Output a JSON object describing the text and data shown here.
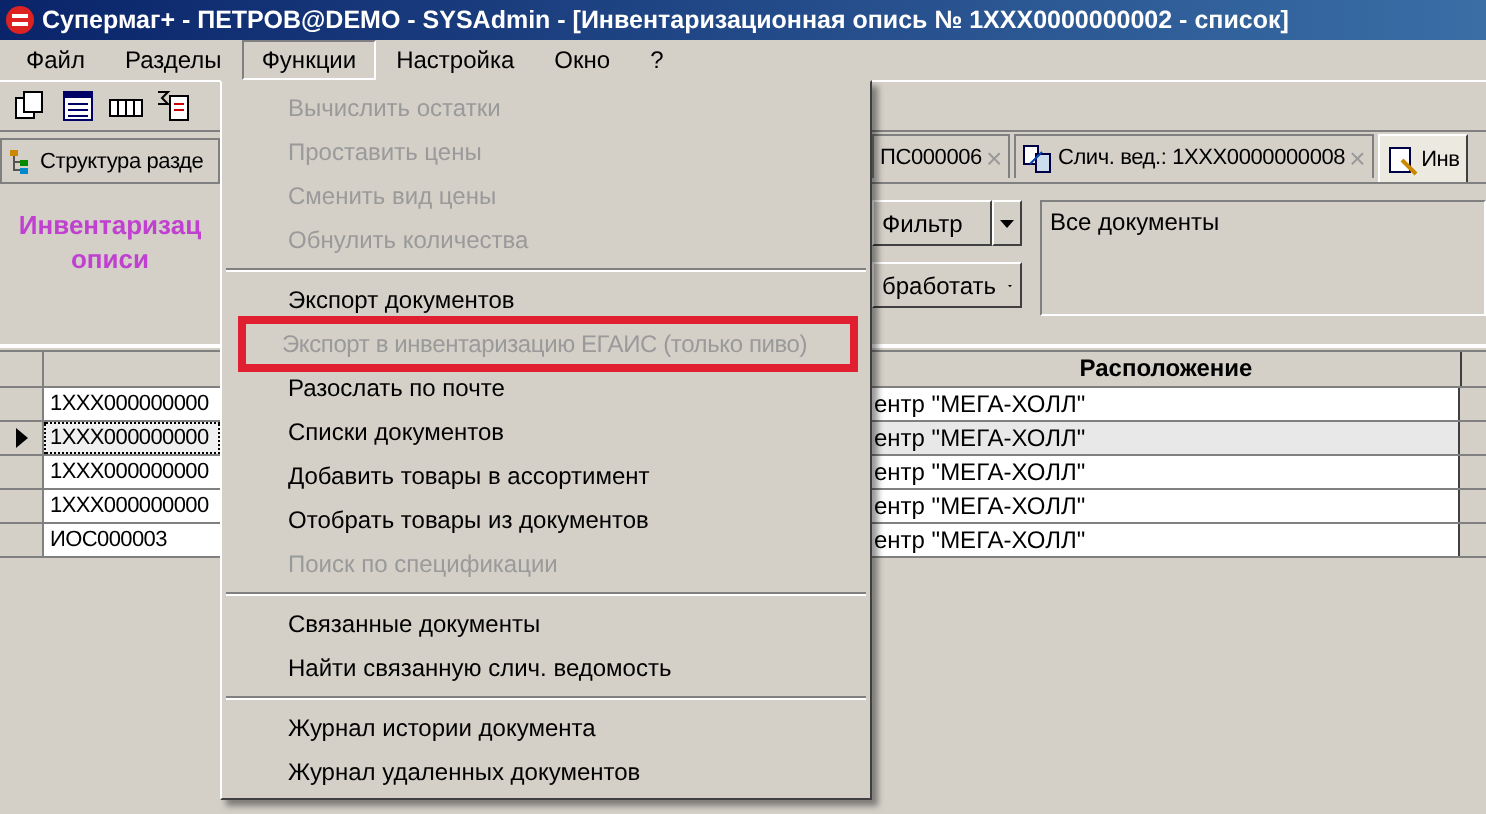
{
  "window": {
    "title": "Супермаг+ - ПЕТРОВ@DEMO - SYSAdmin  - [Инвентаризационная опись № 1XXX0000000002 - список]"
  },
  "menu_bar": [
    {
      "label": "Файл",
      "selected": false
    },
    {
      "label": "Разделы",
      "selected": false
    },
    {
      "label": "Функции",
      "selected": true
    },
    {
      "label": "Настройка",
      "selected": false
    },
    {
      "label": "Окно",
      "selected": false
    },
    {
      "label": "?",
      "selected": false
    }
  ],
  "tabs": [
    {
      "label": "Структура разде",
      "selected": false
    },
    {
      "label": "ПС000006",
      "selected": false,
      "close": "×"
    },
    {
      "label": "Слич. вед.: 1XXX0000000008",
      "selected": false,
      "close": "×"
    },
    {
      "label": "Инв",
      "selected": true
    }
  ],
  "panel": {
    "title_lines": [
      "Инвентаризац",
      "описи"
    ],
    "filter_button": "Фильтр",
    "process_button": "бработать",
    "filter_text": "Все документы"
  },
  "grid": {
    "location_header": "Расположение",
    "rows": [
      {
        "number": "1XXX000000000",
        "location": "ентр \"МЕГА-ХОЛЛ\"",
        "selected": false
      },
      {
        "number": "1XXX000000000",
        "location": "ентр \"МЕГА-ХОЛЛ\"",
        "selected": true
      },
      {
        "number": "1XXX000000000",
        "location": "ентр \"МЕГА-ХОЛЛ\"",
        "selected": false
      },
      {
        "number": "1XXX000000000",
        "location": "ентр \"МЕГА-ХОЛЛ\"",
        "selected": false
      },
      {
        "number": "ИОС000003",
        "location": "ентр \"МЕГА-ХОЛЛ\"",
        "selected": false
      }
    ]
  },
  "dropdown": [
    {
      "kind": "item",
      "label": "Вычислить остатки",
      "disabled": true,
      "annotated": false
    },
    {
      "kind": "item",
      "label": "Проставить цены",
      "disabled": true,
      "annotated": false
    },
    {
      "kind": "item",
      "label": "Сменить вид цены",
      "disabled": true,
      "annotated": false
    },
    {
      "kind": "item",
      "label": "Обнулить количества",
      "disabled": true,
      "annotated": false
    },
    {
      "kind": "separator"
    },
    {
      "kind": "item",
      "label": "Экспорт документов",
      "disabled": false,
      "annotated": false
    },
    {
      "kind": "item",
      "label": "Экспорт в инвентаризацию ЕГАИС (только пиво)",
      "disabled": true,
      "annotated": true
    },
    {
      "kind": "item",
      "label": "Разослать по почте",
      "disabled": false,
      "annotated": false
    },
    {
      "kind": "item",
      "label": "Списки документов",
      "disabled": false,
      "annotated": false
    },
    {
      "kind": "item",
      "label": "Добавить товары в ассортимент",
      "disabled": false,
      "annotated": false
    },
    {
      "kind": "item",
      "label": "Отобрать товары из документов",
      "disabled": false,
      "annotated": false
    },
    {
      "kind": "item",
      "label": "Поиск по спецификации",
      "disabled": true,
      "annotated": false
    },
    {
      "kind": "separator"
    },
    {
      "kind": "item",
      "label": "Связанные документы",
      "disabled": false,
      "annotated": false
    },
    {
      "kind": "item",
      "label": "Найти связанную слич. ведомость",
      "disabled": false,
      "annotated": false
    },
    {
      "kind": "separator"
    },
    {
      "kind": "item",
      "label": "Журнал истории документа",
      "disabled": false,
      "annotated": false
    },
    {
      "kind": "item",
      "label": "Журнал удаленных документов",
      "disabled": false,
      "annotated": false
    }
  ]
}
